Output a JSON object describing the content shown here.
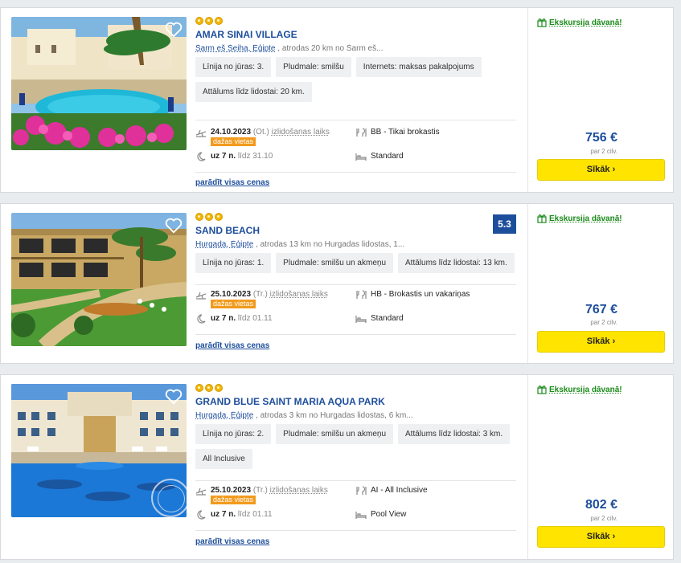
{
  "hotels": [
    {
      "name": "AMAR SINAI VILLAGE",
      "location": "Šarm eš Šeiha, Ēģipte",
      "distance_text": ", atrodas 20 km no Šarm eš...",
      "tags": [
        "Līnija no jūras: 3.",
        "Pludmale: smilšu",
        "Internets: maksas pakalpojums",
        "Attālums līdz lidostai: 20 km."
      ],
      "date": "24.10.2023",
      "weekday": "(Ot.)",
      "departure_label": "izlidošanas laiks",
      "seats_badge": "dažas vietas",
      "nights": "uz 7 n.",
      "till": "līdz 31.10",
      "meal": "BB - Tikai brokastis",
      "room": "Standard",
      "show_prices": "parādīt visas cenas",
      "gift": "Ekskursija dāvanā!",
      "price": "756 €",
      "per": "par 2 cilv.",
      "button": "Sīkāk ›",
      "rating": ""
    },
    {
      "name": "SAND BEACH",
      "location": "Hurgada, Ēģipte",
      "distance_text": ", atrodas 13 km no Hurgadas lidostas, 1...",
      "tags": [
        "Līnija no jūras: 1.",
        "Pludmale: smilšu un akmeņu",
        "Attālums līdz lidostai: 13 km."
      ],
      "date": "25.10.2023",
      "weekday": "(Tr.)",
      "departure_label": "izlidošanas laiks",
      "seats_badge": "dažas vietas",
      "nights": "uz 7 n.",
      "till": "līdz 01.11",
      "meal": "HB - Brokastis un vakariņas",
      "room": "Standard",
      "show_prices": "parādīt visas cenas",
      "gift": "Ekskursija dāvanā!",
      "price": "767 €",
      "per": "par 2 cilv.",
      "button": "Sīkāk ›",
      "rating": "5.3"
    },
    {
      "name": "GRAND BLUE SAINT MARIA AQUA PARK",
      "location": "Hurgada, Ēģipte",
      "distance_text": ", atrodas 3 km no Hurgadas lidostas, 6 km...",
      "tags": [
        "Līnija no jūras: 2.",
        "Pludmale: smilšu un akmeņu",
        "Attālums līdz lidostai: 3 km.",
        "All Inclusive"
      ],
      "date": "25.10.2023",
      "weekday": "(Tr.)",
      "departure_label": "izlidošanas laiks",
      "seats_badge": "dažas vietas",
      "nights": "uz 7 n.",
      "till": "līdz 01.11",
      "meal": "AI - All Inclusive",
      "room": "Pool View",
      "show_prices": "parādīt visas cenas",
      "gift": "Ekskursija dāvanā!",
      "price": "802 €",
      "per": "par 2 cilv.",
      "button": "Sīkāk ›",
      "rating": ""
    }
  ],
  "colors": {
    "brand_blue": "#1d4e9c",
    "button_yellow": "#ffe400",
    "seats_orange": "#f29a1d",
    "gift_green": "#1a8a1a"
  },
  "icons": [
    "heart-icon",
    "plane-icon",
    "meal-icon",
    "moon-icon",
    "bed-icon",
    "gift-icon",
    "star-icon"
  ]
}
